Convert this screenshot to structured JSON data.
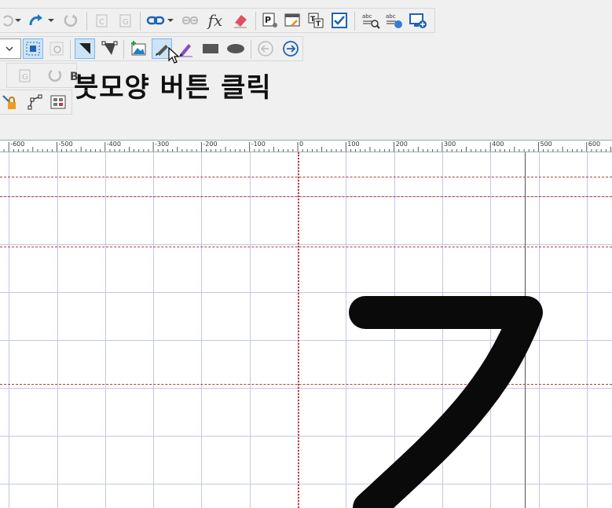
{
  "caption": "붓모양 버튼 클릭",
  "toolbar": {
    "row1": [
      "undo-icon",
      "undo-dropdown-icon",
      "redo-icon",
      "redo-dropdown-icon",
      "refresh-icon",
      "copy-c-icon",
      "copy-g-icon",
      "link-icon",
      "link-dropdown-icon",
      "unlink-icon",
      "fx-icon",
      "eraser-icon",
      "p-settings-icon",
      "window-edit-icon",
      "text-tool-icon",
      "checkbox-icon",
      "abc-search-icon",
      "abc-globe-icon",
      "monitor-add-icon"
    ],
    "row2": [
      "select-dropdown",
      "fit-selection-icon",
      "zoom-icon",
      "pointer-tool-icon",
      "node-tool-icon",
      "add-image-icon",
      "brush-tool-icon",
      "pencil-tool-icon",
      "rectangle-tool-icon",
      "ellipse-tool-icon",
      "previous-arrow-icon",
      "next-arrow-icon"
    ],
    "row3": [
      "g-icon",
      "rotate-icon",
      "b-icon"
    ],
    "row4": [
      "lock-node-icon",
      "path-node-icon",
      "grid-component-icon"
    ],
    "fx_label": "fx"
  },
  "ruler": {
    "labels": [
      "-600",
      "-500",
      "-400",
      "-300",
      "-200",
      "-100",
      "0",
      "100",
      "200",
      "300",
      "400",
      "500",
      "600"
    ]
  },
  "colors": {
    "grid": "#c4c6e8",
    "guide": "#c23a3a",
    "glyph": "#0a0a0a",
    "selection": "#cce4f7"
  },
  "glyph": {
    "description_char": "ㄱ"
  }
}
